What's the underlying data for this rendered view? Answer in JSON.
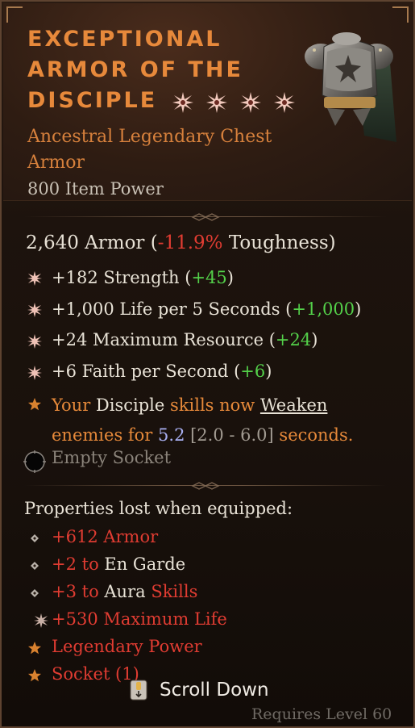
{
  "item": {
    "title_lines": [
      "EXCEPTIONAL",
      "ARMOR OF THE",
      "DISCIPLE"
    ],
    "subtitle": "Ancestral Legendary Chest Armor",
    "item_power": "800 Item Power",
    "greater_affix_icons": [
      "star-burst-icon",
      "star-burst-icon",
      "star-burst-icon",
      "star-burst-icon"
    ]
  },
  "armor": {
    "value": "2,640 Armor (",
    "delta": "-11.9%",
    "suffix": " Toughness)"
  },
  "stats": [
    {
      "text": "+182 Strength (",
      "delta": "+45",
      "close": ")"
    },
    {
      "text": "+1,000 Life per 5 Seconds (",
      "delta": "+1,000",
      "close": ")"
    },
    {
      "text": "+24 Maximum Resource (",
      "delta": "+24",
      "close": ")"
    },
    {
      "text": "+6 Faith per Second (",
      "delta": "+6",
      "close": ")"
    }
  ],
  "legendary": {
    "p1": "Your ",
    "p2": "Disciple",
    "p3": " skills now ",
    "p4": "Weaken",
    "p5": "enemies for ",
    "p6": "5.2",
    "p7": " [2.0 - 6.0]",
    "p8": " seconds."
  },
  "socket": {
    "label": "Empty Socket"
  },
  "lost": {
    "title": "Properties lost when equipped:",
    "items": [
      {
        "a": "+612 Armor",
        "b": "",
        "c": ""
      },
      {
        "a": "+2 to ",
        "b": "En Garde",
        "c": ""
      },
      {
        "a": "+3 to ",
        "b": "Aura",
        "c": " Skills"
      },
      {
        "a": "+530 Maximum Life",
        "b": "",
        "c": ""
      },
      {
        "a": "Legendary Power",
        "b": "",
        "c": ""
      },
      {
        "a": "Socket (1)",
        "b": "",
        "c": ""
      }
    ]
  },
  "footer": {
    "scroll_label": "Scroll Down",
    "requirement": "Requires Level 60"
  },
  "colors": {
    "title": "#e7893b",
    "negative": "#e03c32",
    "positive": "#54d14a",
    "legendary": "#e6893a",
    "value_highlight": "#a9b0f2"
  }
}
